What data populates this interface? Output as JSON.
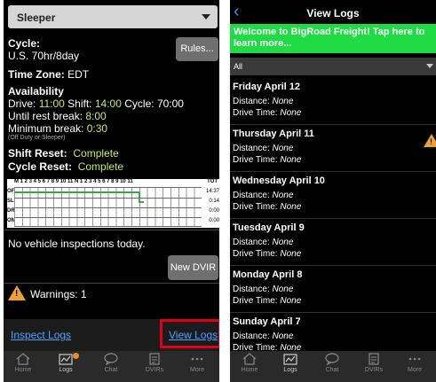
{
  "left": {
    "status": "Sleeper",
    "cycle": {
      "label": "Cycle:",
      "value": "U.S. 70hr/8day"
    },
    "rules_button": "Rules...",
    "time_zone": {
      "label": "Time Zone:",
      "value": "EDT"
    },
    "availability": {
      "label": "Availability",
      "drive_label": "Drive:",
      "drive": "11:00",
      "shift_label": "Shift:",
      "shift": "14:00",
      "cycle_label": "Cycle:",
      "cycle": "70:00",
      "rest_label": "Until rest break:",
      "rest": "8:00",
      "min_label": "Minimum break:",
      "min": "0:30",
      "min_note": "(Off Duty or Sleeper)"
    },
    "shift_reset": {
      "label": "Shift Reset:",
      "value": "Complete"
    },
    "cycle_reset": {
      "label": "Cycle Reset:",
      "value": "Complete"
    },
    "log_grid": {
      "header": "M 1 2 3 4 5 6 7 8 9 10 11 N 1 2 3 4 5 6 7 8 9 10 11",
      "total_label": "TOT",
      "rows": [
        {
          "code": "OF",
          "total": "14:37"
        },
        {
          "code": "SL",
          "total": "0:14"
        },
        {
          "code": "DR",
          "total": "0:00"
        },
        {
          "code": "ON",
          "total": "0:00"
        }
      ]
    },
    "inspections_text": "No vehicle inspections today.",
    "new_dvir_button": "New DVIR",
    "warnings": "Warnings: 1",
    "inspect_logs_link": "Inspect Logs",
    "view_logs_link": "View Logs",
    "tabs": [
      "Home",
      "Logs",
      "Chat",
      "DVIRs",
      "More"
    ],
    "active_tab": "Logs"
  },
  "right": {
    "title": "View Logs",
    "banner": "Welcome to BigRoad Freight! Tap here to learn more...",
    "filter": "All",
    "logs": [
      {
        "day": "Friday April 12",
        "distance_label": "Distance:",
        "distance": "None",
        "drive_label": "Drive Time:",
        "drive": "None",
        "warning": false
      },
      {
        "day": "Thursday April 11",
        "distance_label": "Distance:",
        "distance": "None",
        "drive_label": "Drive Time:",
        "drive": "None",
        "warning": true
      },
      {
        "day": "Wednesday April 10",
        "distance_label": "Distance:",
        "distance": "None",
        "drive_label": "Drive Time:",
        "drive": "None",
        "warning": false
      },
      {
        "day": "Tuesday April 9",
        "distance_label": "Distance:",
        "distance": "None",
        "drive_label": "Drive Time:",
        "drive": "None",
        "warning": false
      },
      {
        "day": "Monday April 8",
        "distance_label": "Distance:",
        "distance": "None",
        "drive_label": "Drive Time:",
        "drive": "None",
        "warning": false
      },
      {
        "day": "Sunday April 7",
        "distance_label": "Distance:",
        "distance": "None",
        "drive_label": "Drive Time:",
        "drive": "None",
        "warning": false
      }
    ],
    "tabs": [
      "Home",
      "Logs",
      "Chat",
      "DVIRs",
      "More"
    ],
    "active_tab": "Logs"
  },
  "colors": {
    "accent_green": "#c9e85b",
    "banner_green": "#1fdc45",
    "link_blue": "#4aa3ff",
    "highlight_red": "#e0001a",
    "warning_orange": "#f0a030"
  }
}
